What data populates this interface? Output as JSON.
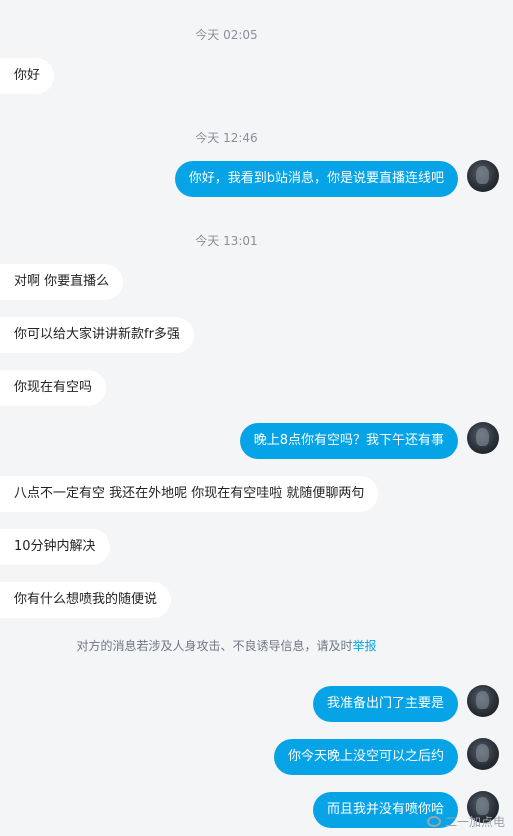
{
  "timestamps": [
    "今天 02:05",
    "今天 12:46",
    "今天 13:01"
  ],
  "messages": [
    {
      "side": "left",
      "text": "你好"
    },
    {
      "side": "right",
      "text": "你好，我看到b站消息，你是说要直播连线吧"
    },
    {
      "side": "left",
      "text": "对啊 你要直播么"
    },
    {
      "side": "left",
      "text": "你可以给大家讲讲新款fr多强"
    },
    {
      "side": "left",
      "text": "你现在有空吗"
    },
    {
      "side": "right",
      "text": "晚上8点你有空吗？我下午还有事"
    },
    {
      "side": "left",
      "text": "八点不一定有空 我还在外地呢 你现在有空哇啦 就随便聊两句"
    },
    {
      "side": "left",
      "text": "10分钟内解决"
    },
    {
      "side": "left",
      "text": "你有什么想喷我的随便说"
    },
    {
      "side": "right",
      "text": "我准备出门了主要是"
    },
    {
      "side": "right",
      "text": "你今天晚上没空可以之后约"
    },
    {
      "side": "right",
      "text": "而且我并没有喷你哈"
    }
  ],
  "notice": {
    "text": "对方的消息若涉及人身攻击、不良诱导信息，请及时",
    "link": "举报"
  },
  "watermark": "二一加点电",
  "colors": {
    "accent": "#06a4e6",
    "background": "#f4f5f7"
  }
}
